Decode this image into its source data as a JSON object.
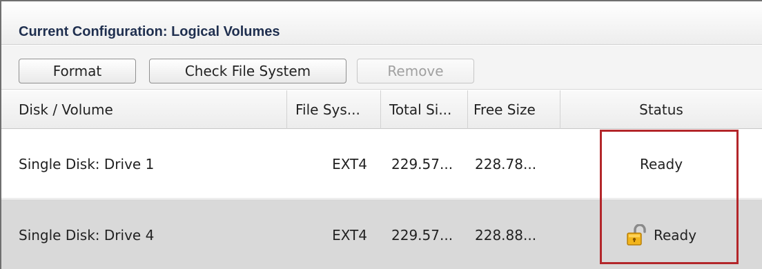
{
  "panel": {
    "title": "Current Configuration: Logical Volumes"
  },
  "toolbar": {
    "format_label": "Format",
    "check_fs_label": "Check File System",
    "remove_label": "Remove"
  },
  "table": {
    "columns": [
      "Disk / Volume",
      "File Sys...",
      "Total Si...",
      "Free Size",
      "Status"
    ],
    "rows": [
      {
        "disk": "Single Disk: Drive 1",
        "fs": "EXT4",
        "total": "229.57...",
        "free": "228.78...",
        "status": "Ready",
        "icon": null
      },
      {
        "disk": "Single Disk: Drive 4",
        "fs": "EXT4",
        "total": "229.57...",
        "free": "228.88...",
        "status": "Ready",
        "icon": "unlocked-padlock-icon"
      }
    ]
  },
  "colors": {
    "highlight": "#b3262a",
    "selected_row": "#d9d9d9",
    "title_text": "#1f2f4f"
  }
}
